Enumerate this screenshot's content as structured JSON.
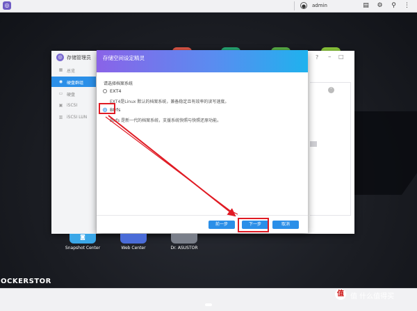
{
  "topbar": {
    "user": "admin"
  },
  "storage_manager": {
    "title": "存储管理员",
    "sidebar": [
      {
        "label": "总览",
        "icon": "overview-icon"
      },
      {
        "label": "硬盘群组",
        "icon": "disk-group-icon"
      },
      {
        "label": "硬盘",
        "icon": "disk-icon"
      },
      {
        "label": "iSCSI",
        "icon": "iscsi-icon"
      },
      {
        "label": "iSCSI LUN",
        "icon": "iscsi-lun-icon"
      }
    ]
  },
  "wizard": {
    "title": "存储空间设定精灵",
    "prompt": "请选择档案系统",
    "options": [
      {
        "label": "EXT4",
        "selected": false,
        "description": "EXT4是Linux 默认的档案系统，兼备稳定且有效率的读写速度。"
      },
      {
        "label": "Btrfs",
        "selected": true,
        "description": "Btrfs 是新一代的档案系统，支援系统快照与快照还原功能。"
      }
    ],
    "buttons": {
      "prev": "前一步",
      "next": "下一步",
      "cancel": "取消"
    }
  },
  "desktop": {
    "launchers": [
      {
        "label": "Snapshot Center",
        "color": "#3aa7e8"
      },
      {
        "label": "Web Center",
        "color": "#4a6cd8"
      },
      {
        "label": "Dr. ASUSTOR",
        "color": "#7a7f8a"
      }
    ],
    "brand": "OCKERSTOR"
  },
  "watermark": "值 什么值得买",
  "colors": {
    "accent": "#2b8fe8",
    "highlight": "#e01b24",
    "wizard_gradient_start": "#8a63e8",
    "wizard_gradient_end": "#1fb2ee"
  }
}
